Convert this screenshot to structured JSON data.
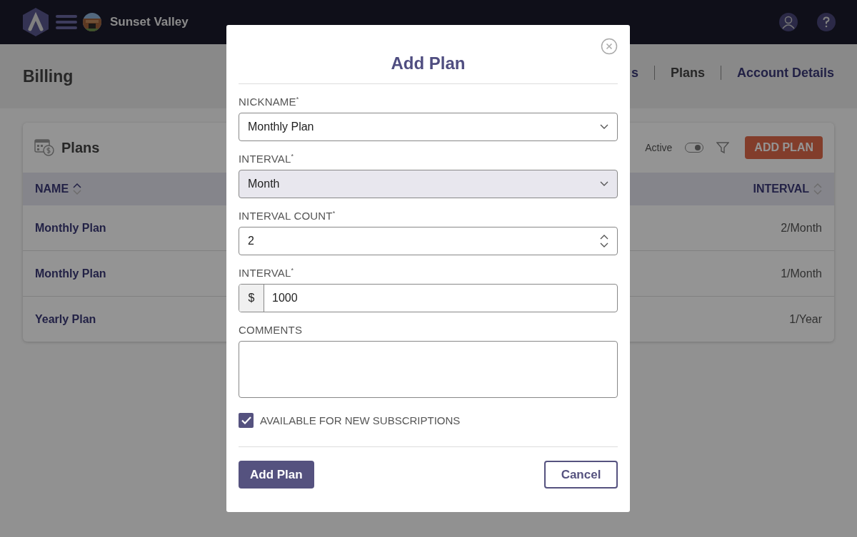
{
  "header": {
    "org_name": "Sunset Valley"
  },
  "page": {
    "title": "Billing",
    "tabs": [
      {
        "label": "s",
        "selected": false
      },
      {
        "label": "Plans",
        "selected": true
      },
      {
        "label": "Account Details",
        "selected": false
      }
    ]
  },
  "plans_card": {
    "title": "Plans",
    "active_label": "Active",
    "active_on": true,
    "add_button": "ADD PLAN",
    "columns": [
      {
        "label": "NAME",
        "sorted": true
      },
      {
        "label": "INTERVAL",
        "sorted": false
      }
    ],
    "rows": [
      {
        "name": "Monthly Plan",
        "interval": "2/Month"
      },
      {
        "name": "Monthly Plan",
        "interval": "1/Month"
      },
      {
        "name": "Yearly Plan",
        "interval": "1/Year"
      }
    ]
  },
  "modal": {
    "title": "Add Plan",
    "fields": [
      {
        "kind": "select",
        "label": "NICKNAME$^{*}$",
        "value": "Monthly Plan",
        "disabled": false
      },
      {
        "kind": "select",
        "label": "INTERVAL$^{*}$",
        "value": "Month",
        "disabled": true
      },
      {
        "kind": "number",
        "label": "INTERVAL COUNT$^{*}$",
        "value": "2"
      },
      {
        "kind": "currency",
        "label": "INTERVAL$^{*}$",
        "prefix": "$",
        "value": "1000"
      },
      {
        "kind": "textarea",
        "label": "COMMENTS"
      }
    ],
    "checkbox": {
      "label": "AVAILABLE FOR NEW SUBSCRIPTIONS",
      "checked": true
    },
    "submit": "Add Plan",
    "cancel": "Cancel"
  }
}
